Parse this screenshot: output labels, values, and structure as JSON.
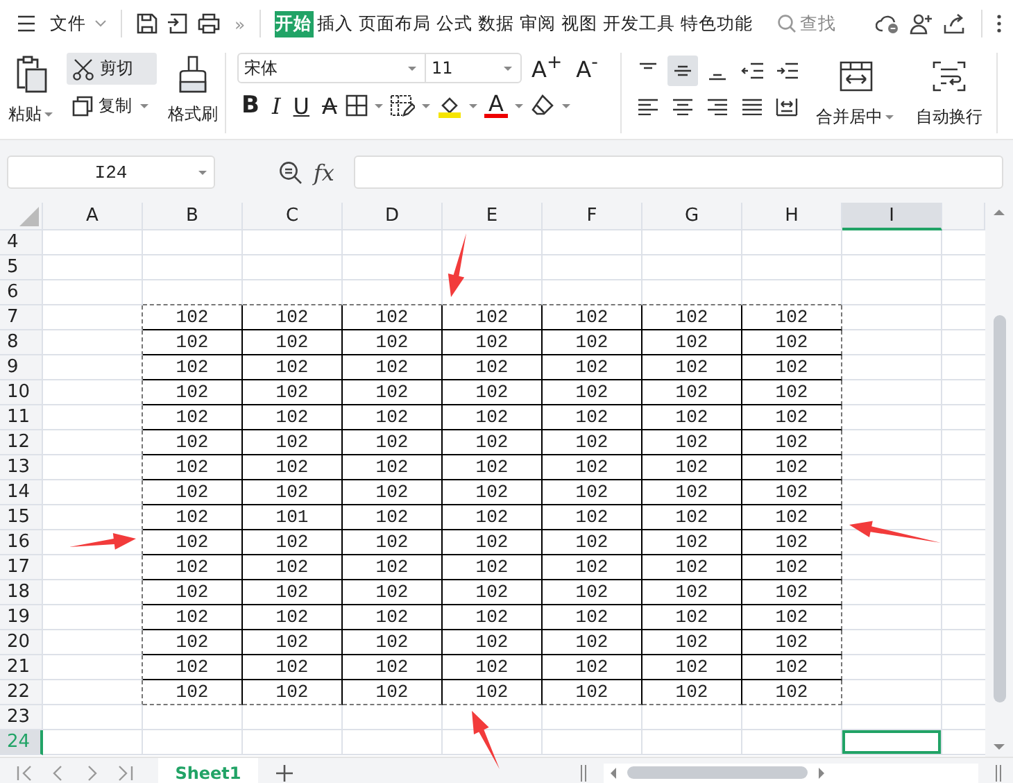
{
  "menu_bar": {
    "file_menu": "文件",
    "more": "»",
    "tabs": [
      {
        "label": "开始",
        "selected": true
      },
      {
        "label": "插入",
        "selected": false
      },
      {
        "label": "页面布局",
        "selected": false
      },
      {
        "label": "公式",
        "selected": false
      },
      {
        "label": "数据",
        "selected": false
      },
      {
        "label": "审阅",
        "selected": false
      },
      {
        "label": "视图",
        "selected": false
      },
      {
        "label": "开发工具",
        "selected": false
      },
      {
        "label": "特色功能",
        "selected": false
      }
    ],
    "search": "查找"
  },
  "ribbon": {
    "paste": "粘贴",
    "cut": {
      "label": "剪切",
      "highlighted": true
    },
    "copy": "复制",
    "format_painter": "格式刷",
    "font": "宋体",
    "font_size": "11",
    "grow_font": "A$^{+}$",
    "shrink_font": "A$^{-}$",
    "format_buttons": [
      {
        "kind": "bold",
        "label": "B"
      },
      {
        "kind": "italic",
        "label": "I"
      },
      {
        "kind": "underline",
        "label": "U"
      },
      {
        "kind": "strike",
        "label": "A"
      }
    ],
    "font_color": "A",
    "vertical_align": [
      {
        "kind": "top",
        "selected": false
      },
      {
        "kind": "middle",
        "selected": true
      },
      {
        "kind": "bottom",
        "selected": false
      }
    ],
    "merge": "合并居中",
    "wrap": "自动换行"
  },
  "formula_bar": {
    "name_box": "I24",
    "fx": "fx"
  },
  "sheet": {
    "columns": [
      {
        "label": "A",
        "selected": false
      },
      {
        "label": "B",
        "selected": false
      },
      {
        "label": "C",
        "selected": false
      },
      {
        "label": "D",
        "selected": false
      },
      {
        "label": "E",
        "selected": false
      },
      {
        "label": "F",
        "selected": false
      },
      {
        "label": "G",
        "selected": false
      },
      {
        "label": "H",
        "selected": false
      },
      {
        "label": "I",
        "selected": true
      }
    ],
    "rows": [
      {
        "label": "4",
        "selected": false
      },
      {
        "label": "5",
        "selected": false
      },
      {
        "label": "6",
        "selected": false
      },
      {
        "label": "7",
        "selected": false,
        "cells": [
          "102",
          "102",
          "102",
          "102",
          "102",
          "102",
          "102"
        ]
      },
      {
        "label": "8",
        "selected": false,
        "cells": [
          "102",
          "102",
          "102",
          "102",
          "102",
          "102",
          "102"
        ]
      },
      {
        "label": "9",
        "selected": false,
        "cells": [
          "102",
          "102",
          "102",
          "102",
          "102",
          "102",
          "102"
        ]
      },
      {
        "label": "10",
        "selected": false,
        "cells": [
          "102",
          "102",
          "102",
          "102",
          "102",
          "102",
          "102"
        ]
      },
      {
        "label": "11",
        "selected": false,
        "cells": [
          "102",
          "102",
          "102",
          "102",
          "102",
          "102",
          "102"
        ]
      },
      {
        "label": "12",
        "selected": false,
        "cells": [
          "102",
          "102",
          "102",
          "102",
          "102",
          "102",
          "102"
        ]
      },
      {
        "label": "13",
        "selected": false,
        "cells": [
          "102",
          "102",
          "102",
          "102",
          "102",
          "102",
          "102"
        ]
      },
      {
        "label": "14",
        "selected": false,
        "cells": [
          "102",
          "102",
          "102",
          "102",
          "102",
          "102",
          "102"
        ]
      },
      {
        "label": "15",
        "selected": false,
        "cells": [
          "102",
          "101",
          "102",
          "102",
          "102",
          "102",
          "102"
        ]
      },
      {
        "label": "16",
        "selected": false,
        "cells": [
          "102",
          "102",
          "102",
          "102",
          "102",
          "102",
          "102"
        ]
      },
      {
        "label": "17",
        "selected": false,
        "cells": [
          "102",
          "102",
          "102",
          "102",
          "102",
          "102",
          "102"
        ]
      },
      {
        "label": "18",
        "selected": false,
        "cells": [
          "102",
          "102",
          "102",
          "102",
          "102",
          "102",
          "102"
        ]
      },
      {
        "label": "19",
        "selected": false,
        "cells": [
          "102",
          "102",
          "102",
          "102",
          "102",
          "102",
          "102"
        ]
      },
      {
        "label": "20",
        "selected": false,
        "cells": [
          "102",
          "102",
          "102",
          "102",
          "102",
          "102",
          "102"
        ]
      },
      {
        "label": "21",
        "selected": false,
        "cells": [
          "102",
          "102",
          "102",
          "102",
          "102",
          "102",
          "102"
        ]
      },
      {
        "label": "22",
        "selected": false,
        "cells": [
          "102",
          "102",
          "102",
          "102",
          "102",
          "102",
          "102"
        ]
      },
      {
        "label": "23",
        "selected": false
      },
      {
        "label": "24",
        "selected": true
      }
    ]
  },
  "sheet_tabs": [
    {
      "label": "Sheet1",
      "selected": true
    }
  ]
}
